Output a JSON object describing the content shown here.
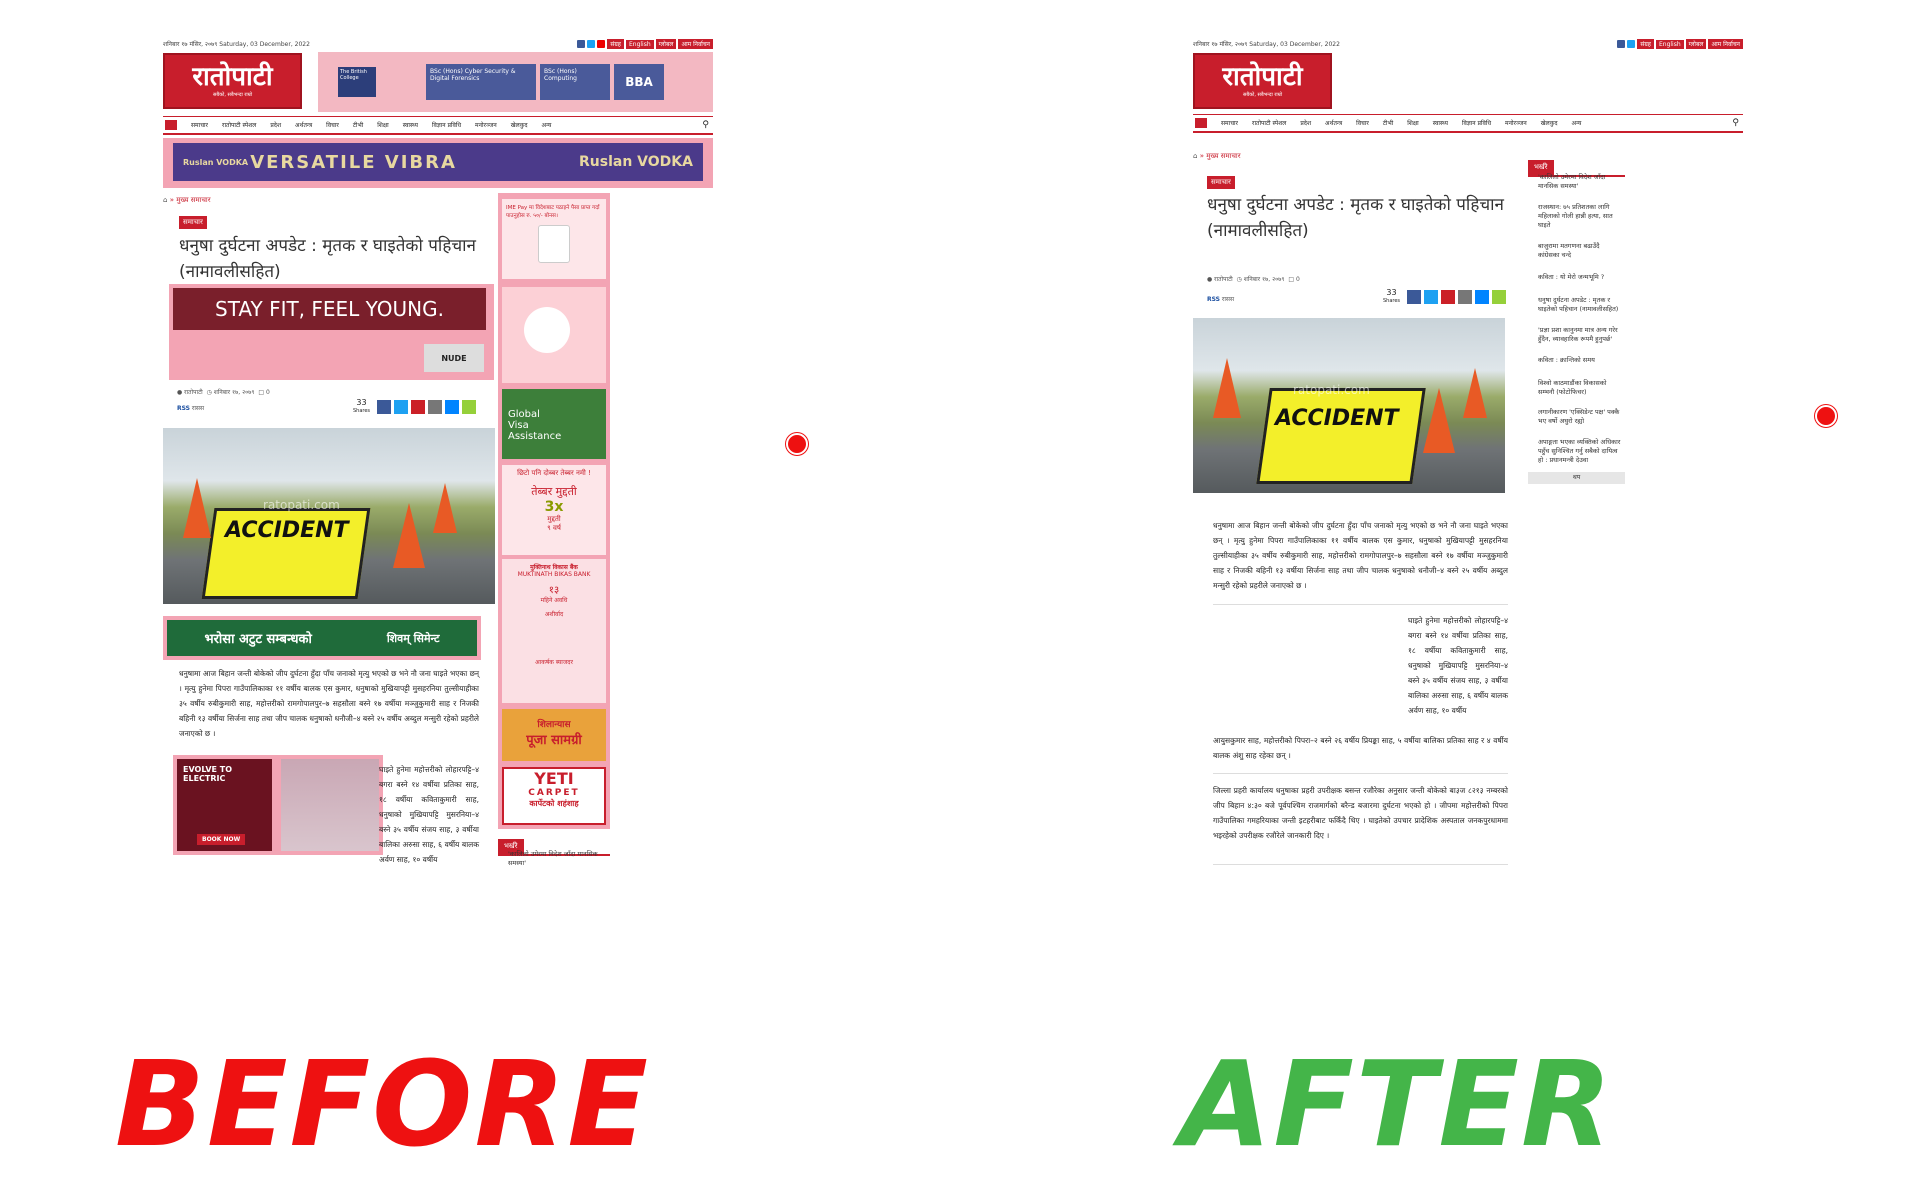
{
  "site": {
    "date_line": "शनिबार १७ मंसिर, २०७९  Saturday, 03 December, 2022",
    "logo_text": "रातोपाटी",
    "logo_tagline": "सबैको, सबैभन्दा राम्रो",
    "top_links": [
      "संग्रह",
      "English",
      "ग्लोबल",
      "आम निर्वाचन"
    ]
  },
  "nav": {
    "items": [
      "समाचार",
      "रातोपाटी स्पेशल",
      "प्रदेश",
      "अर्थतन्त्र",
      "विचार",
      "टीभी",
      "शिक्षा",
      "स्वास्थ्य",
      "विज्ञान प्रविधि",
      "मनोरञ्जन",
      "खेलकुद",
      "अन्य"
    ]
  },
  "ads": {
    "british_college": [
      "The British College",
      "BSc (Hons) Cyber Security & Digital Forensics",
      "BSc (Hons) Computing",
      "BBA"
    ],
    "ruslan": [
      "Ruslan VODKA",
      "VERSATILE VIBRA",
      "Ruslan VODKA"
    ],
    "stay_fit": "STAY FIT, FEEL YOUNG.",
    "nude": "NUDE",
    "shivam": [
      "भरोसा अटुट सम्बन्धको",
      "शिवम् सिमेन्ट"
    ],
    "ime_pay": "IME Pay मा विदेशबाट पठाइने पैसा प्राप्त गर्दा पाउनुहोस रु. ५०/- बोनस।",
    "global_visa": [
      "Global",
      "Visa",
      "Assistance"
    ],
    "deposit": [
      "छिटो पनि दोब्बर तेब्बर नमी !",
      "तेब्बर मुद्दती",
      "3x",
      "मुद्दती",
      "९ वर्ष"
    ],
    "muktinath": [
      "मुक्तिनाथ विकास बैंक",
      "MUKTINATH BIKAS BANK",
      "१३",
      "महिने अवधि",
      "अशीर्वाद",
      "आकर्षक ब्याजदर"
    ],
    "puja": [
      "शिलान्यास",
      "पूजा सामग्री"
    ],
    "yeti": [
      "YETI",
      "CARPET",
      "कार्पेटको शहंशाह"
    ],
    "evolve": [
      "EVOLVE TO ELECTRIC",
      "BOOK NOW"
    ]
  },
  "article": {
    "breadcrumb": "» मुख्य समाचार",
    "category": "समाचार",
    "title_line1": "धनुषा दुर्घटना अपडेट : मृतक र घाइतेको पहिचान",
    "title_line2": "(नामावलीसहित)",
    "author": "रातोपाटी",
    "date": "शनिबार १७, २०७९",
    "comments": "0",
    "reporter": "रासस",
    "reporter_code": "RSS",
    "share_count": "33",
    "share_label": "Shares",
    "image_caption": "ACCIDENT",
    "watermark": "ratopati.com",
    "para1": "धनुषामा आज बिहान जन्ती बोकेको जीप दुर्घटना हुँदा पाँच जनाको मृत्यु भएको छ भने नौ जना घाइते भएका छन् । मृत्यु हुनेमा पिपरा गाउँपालिकाका ११ वर्षीय बालक एस कुमार, धनुषाको मुखियापट्टी मुसहरनिया तुल्सीयाहीका ३५ वर्षीय रुबीकुमारी साह, महोत्तरीको रामगोपालपुर–७ सहसौला बस्ने १७ वर्षीया मञ्जुकुमारी साह र निजकी बहिनी १३ वर्षीया सिर्जना साह तथा जीप चालक धनुषाको धनौजी–४ बस्ने २५ वर्षीय अब्दुल मन्सुरी रहेको प्रहरीले जनाएको छ ।",
    "para2": "घाइते हुनेमा महोत्तरीको लोहारपट्टि–४ बगरा बस्ने १४ वर्षीया प्रतिका साह, १८ वर्षीया कविताकुमारी साह, धनुषाको मुखियापट्टि मुसरनिया–४ बस्ने ३५ वर्षीय संजय साह, ३ वर्षीया बालिका अरुसा साह, ६ वर्षीय बालक अर्वण साह, १० वर्षीय",
    "para2_cont": "आयुसकुमार साह, महोत्तरीको पिपरा–२ बस्ने २६ वर्षीय प्रियङ्का साह, ५ वर्षीया बालिका प्रतिका साह र ४ वर्षीय बालक अंशु साह रहेका छन् ।",
    "para3": "जिल्ला प्रहरी कार्यालय धनुषाका प्रहरी उपरीक्षक बसन्त रजौरेका अनुसार जन्ती बोकेको बा३ज ८२१३ नम्बरको जीप बिहान ४:३० बजे पूर्वपश्चिम राजमार्गको बरैन्ड बजारमा दुर्घटना भएको हो । जीपमा महोत्तरीको पिपरा गाउँपालिका गमहरियाका जन्ती इटहरीबाट फर्किंदै थिए । घाइतेको उपचार प्रादेशिक अस्पताल जनकपुरधाममा भइरहेको उपरीक्षक रजौरेले जानकारी दिए ।"
  },
  "sidebar": {
    "heading": "भर्खरै",
    "items": [
      "'कालिलो उमेरमा विदेश जाँदा मानसिक समस्या'",
      "राजस्थान: ७५ प्रतिशतका लागि महिलाको गोली हान्नी हत्या, सात घाइते",
      "बाजुरामा मतगणना बढाउँदै कांग्रेसका चन्दे",
      "कविता : यो मेरो जन्मभूमि ?",
      "धनुषा दुर्घटना अपडेट : मृतक र घाइतेको पहिचान (नामावलीसहित)",
      "'प्रज्ञा प्रशा कानुनमा मात्र अन्य गरेर हुँदैन, व्यावहारिक रूपमै हुनुपर्छ'",
      "कविता : क्रान्तिको समय",
      "विश्वो काठमाडौंका विकासको सम्भनौ (फोटोफिचर)",
      "लगानीकारण 'एक्सिडेन्ट पक्ष' पक्कै भए वर्षो अघुरो रह्यो",
      "अपाङ्गता भएका व्यक्तिको अधिकार पहुँच सुनिश्चित गर्नु सबैको दायित्व हो : प्रधानमन्त्री देउवा"
    ],
    "more": "थप"
  },
  "labels": {
    "before": "BEFORE",
    "after": "AFTER"
  },
  "colors": {
    "brand_red": "#c81e2c",
    "before_red": "#ee1111",
    "after_green": "#44b549",
    "ad_overlay": "#ff8296"
  }
}
